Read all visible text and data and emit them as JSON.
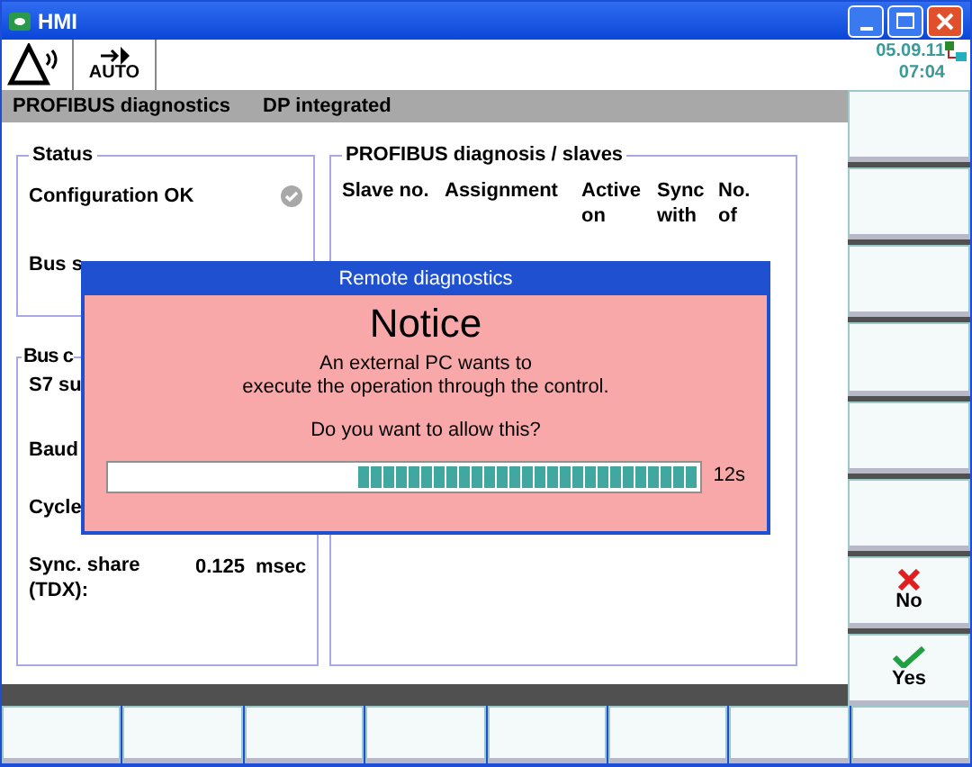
{
  "window": {
    "title": "HMI"
  },
  "header": {
    "mode_label": "AUTO",
    "date": "05.09.11",
    "time": "07:04"
  },
  "breadcrumb": [
    "PROFIBUS diagnostics",
    "DP integrated"
  ],
  "status_panel": {
    "title": "Status",
    "configuration": {
      "label": "Configuration OK",
      "ok": true
    },
    "bus_label": "Bus s"
  },
  "bus_panel": {
    "title": "Bus c",
    "rows": [
      {
        "label": "S7 su"
      },
      {
        "label": "Baud"
      },
      {
        "label": "Cycle"
      },
      {
        "label": "Sync. share (TDX):",
        "value": "0.125",
        "unit": "msec"
      }
    ]
  },
  "slaves_panel": {
    "title": "PROFIBUS diagnosis / slaves",
    "columns": [
      "Slave no.",
      "Assignment",
      "Active on",
      "Sync with",
      "No. of"
    ]
  },
  "dialog": {
    "title": "Remote diagnostics",
    "heading": "Notice",
    "message": "An external PC wants to\nexecute the operation through the control.",
    "question": "Do you want to allow this?",
    "countdown": {
      "level": 0.58,
      "reading": "12s"
    }
  },
  "softkeys_right": [
    {
      "kind": "blank"
    },
    {
      "kind": "blank"
    },
    {
      "kind": "blank"
    },
    {
      "kind": "blank"
    },
    {
      "kind": "blank"
    },
    {
      "kind": "blank"
    },
    {
      "kind": "cancel",
      "label": "No"
    },
    {
      "kind": "confirm",
      "label": "Yes"
    }
  ]
}
